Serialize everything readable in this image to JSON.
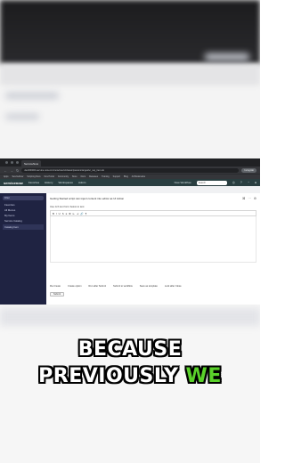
{
  "browser": {
    "tab_title": "ServiceNow",
    "url": "dev000000.service-now.com/now/nav/ui/classic/params/target/sc_req_item.do",
    "profile_label": "Incognito",
    "bookmarks": [
      "Apps",
      "ServiceNow",
      "Scripting Docs",
      "Dev Portal",
      "Community",
      "Store",
      "Docs",
      "Releases",
      "Training",
      "Support",
      "Blog",
      "All Bookmarks"
    ]
  },
  "servicenow": {
    "logo": "servicenow",
    "menus": [
      "Favorites",
      "History",
      "Workspaces",
      "Admin"
    ],
    "workspace_label": "Now Workflow",
    "search_placeholder": "Search"
  },
  "sidebar": {
    "filter_placeholder": "Filter",
    "items": [
      "Favorites",
      "All Menus",
      "My Items",
      "Service Catalog"
    ],
    "selected_item": "Catalog Item"
  },
  "form": {
    "title": "Getting Started script can inject content into editor as UI Action",
    "subtitle": "Use rich text form below to test",
    "editor_toolbar": [
      "B",
      "I",
      "U",
      "S",
      "≡",
      "≣",
      "⇤",
      "⇥",
      "🔗",
      "¶"
    ],
    "options": [
      "Re-Create",
      "Create option",
      "Run after Submit",
      "Submit to workflow",
      "Save as template",
      "Lock after Close"
    ],
    "submit_label": "Submit"
  },
  "caption": {
    "line1": "BECAUSE",
    "line2_prefix": "PREVIOUSLY ",
    "line2_highlight": "WE",
    "highlight_color": "#5ad12a"
  }
}
